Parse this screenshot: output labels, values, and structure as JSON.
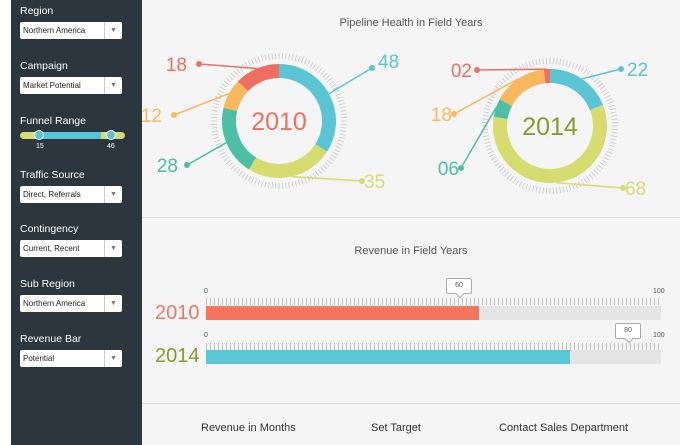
{
  "filters": [
    {
      "label": "Region",
      "value": "Northern America"
    },
    {
      "label": "Campaign",
      "value": "Market Potential"
    },
    {
      "label": "Traffic Source",
      "value": "Direct, Referrals"
    },
    {
      "label": "Contingency",
      "value": "Current, Recent"
    },
    {
      "label": "Sub Region",
      "value": "Northern America"
    },
    {
      "label": "Revenue Bar",
      "value": "Potential"
    }
  ],
  "funnel": {
    "label": "Funnel Range",
    "min": "15",
    "max": "46"
  },
  "pipeline": {
    "title": "Pipeline Health in Field Years",
    "donuts": [
      {
        "year": "2010",
        "year_color": "#ef6f5f",
        "segments": [
          {
            "value": 48,
            "label": "48",
            "color": "#5bc4d5"
          },
          {
            "value": 35,
            "label": "35",
            "color": "#d6dc6f"
          },
          {
            "value": 28,
            "label": "28",
            "color": "#4cbfa4"
          },
          {
            "value": 12,
            "label": "12",
            "color": "#f8b85d"
          },
          {
            "value": 18,
            "label": "18",
            "color": "#f06e5f"
          }
        ]
      },
      {
        "year": "2014",
        "year_color": "#8a9a2b",
        "segments": [
          {
            "value": 22,
            "label": "22",
            "color": "#5bc4d5"
          },
          {
            "value": 68,
            "label": "68",
            "color": "#d6dc6f"
          },
          {
            "value": 6,
            "label": "06",
            "color": "#4cbfa4"
          },
          {
            "value": 18,
            "label": "18",
            "color": "#f8b85d"
          },
          {
            "value": 2,
            "label": "02",
            "color": "#f06e5f"
          }
        ]
      }
    ]
  },
  "revenue": {
    "title": "Revenue in Field Years",
    "scale_min": "0",
    "scale_max": "100",
    "bars": [
      {
        "year": "2010",
        "value": 60,
        "label": "60",
        "color": "#f4765f",
        "year_color": "#f4765f"
      },
      {
        "year": "2014",
        "value": 80,
        "label": "80",
        "color": "#5bc8d8",
        "year_color": "#8a9a2b"
      }
    ]
  },
  "footer": {
    "items": [
      "Revenue in Months",
      "Set Target",
      "Contact Sales Department"
    ]
  }
}
